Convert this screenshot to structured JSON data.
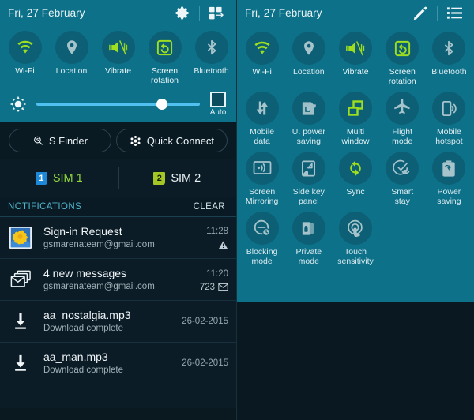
{
  "left_panel": {
    "header": {
      "date": "Fri, 27 February",
      "settings_icon": "gear-icon",
      "grid_icon": "toggle-arrange-icon"
    },
    "toggles": [
      {
        "label": "Wi-Fi",
        "icon": "wifi-icon",
        "active": true
      },
      {
        "label": "Location",
        "icon": "location-pin-icon",
        "active": false
      },
      {
        "label": "Vibrate",
        "icon": "vibrate-icon",
        "active": true
      },
      {
        "label": "Screen\nrotation",
        "label_lines": [
          "Screen",
          "rotation"
        ],
        "icon": "screen-rotation-icon",
        "active": true
      },
      {
        "label": "Bluetooth",
        "icon": "bluetooth-icon",
        "active": false
      }
    ],
    "brightness": {
      "icon": "brightness-sun-icon",
      "value": 77,
      "auto_label": "Auto",
      "auto_checked": false
    },
    "actions": [
      {
        "label": "S Finder",
        "icon": "s-finder-icon"
      },
      {
        "label": "Quick Connect",
        "icon": "quick-connect-icon"
      }
    ],
    "sim": [
      {
        "badge": "1",
        "label": "SIM 1",
        "badge_color": "#1e88d8",
        "text_color": "#8fd43c"
      },
      {
        "badge": "2",
        "label": "SIM 2",
        "badge_color": "#a4c726",
        "text_color": "#e8f1f4"
      }
    ],
    "notifications_header": {
      "title": "NOTIFICATIONS",
      "clear_label": "CLEAR"
    },
    "notifications": [
      {
        "icon": "photo-flower-icon",
        "title": "Sign-in Request",
        "subtitle": "gsmarenateam@gmail.com",
        "time": "11:28",
        "badge_text": "",
        "badge_icon": "warning-triangle-icon"
      },
      {
        "icon": "gmail-stack-icon",
        "title": "4 new messages",
        "subtitle": "gsmarenateam@gmail.com",
        "time": "11:20",
        "badge_text": "723",
        "badge_icon": "mail-icon"
      },
      {
        "icon": "download-icon",
        "title": "aa_nostalgia.mp3",
        "subtitle": "Download complete",
        "time": "26-02-2015",
        "badge_text": "",
        "badge_icon": ""
      },
      {
        "icon": "download-icon",
        "title": "aa_man.mp3",
        "subtitle": "Download complete",
        "time": "26-02-2015",
        "badge_text": "",
        "badge_icon": ""
      }
    ]
  },
  "right_panel": {
    "header": {
      "date": "Fri, 27 February",
      "edit_icon": "pencil-icon",
      "list_icon": "list-view-icon"
    },
    "toggles": [
      {
        "label_lines": [
          "Wi-Fi"
        ],
        "icon": "wifi-icon",
        "active": true
      },
      {
        "label_lines": [
          "Location"
        ],
        "icon": "location-pin-icon",
        "active": false
      },
      {
        "label_lines": [
          "Vibrate"
        ],
        "icon": "vibrate-icon",
        "active": true
      },
      {
        "label_lines": [
          "Screen",
          "rotation"
        ],
        "icon": "screen-rotation-icon",
        "active": true
      },
      {
        "label_lines": [
          "Bluetooth"
        ],
        "icon": "bluetooth-icon",
        "active": false
      },
      {
        "label_lines": [
          "Mobile",
          "data"
        ],
        "icon": "mobile-data-icon",
        "active": false
      },
      {
        "label_lines": [
          "U. power",
          "saving"
        ],
        "icon": "ultra-power-saving-icon",
        "active": false
      },
      {
        "label_lines": [
          "Multi",
          "window"
        ],
        "icon": "multi-window-icon",
        "active": true
      },
      {
        "label_lines": [
          "Flight",
          "mode"
        ],
        "icon": "airplane-icon",
        "active": false
      },
      {
        "label_lines": [
          "Mobile",
          "hotspot"
        ],
        "icon": "mobile-hotspot-icon",
        "active": false
      },
      {
        "label_lines": [
          "Screen",
          "Mirroring"
        ],
        "icon": "screen-mirroring-icon",
        "active": false
      },
      {
        "label_lines": [
          "Side key",
          "panel"
        ],
        "icon": "side-key-panel-icon",
        "active": false
      },
      {
        "label_lines": [
          "Sync"
        ],
        "icon": "sync-icon",
        "active": true
      },
      {
        "label_lines": [
          "Smart",
          "stay"
        ],
        "icon": "smart-stay-icon",
        "active": false
      },
      {
        "label_lines": [
          "Power",
          "saving"
        ],
        "icon": "power-saving-icon",
        "active": false
      },
      {
        "label_lines": [
          "Blocking",
          "mode"
        ],
        "icon": "blocking-mode-icon",
        "active": false
      },
      {
        "label_lines": [
          "Private",
          "mode"
        ],
        "icon": "private-mode-icon",
        "active": false
      },
      {
        "label_lines": [
          "Touch",
          "sensitivity"
        ],
        "icon": "touch-sensitivity-icon",
        "active": false
      }
    ]
  },
  "colors": {
    "teal_bg": "#0d7189",
    "circle_bg": "#0c5f74",
    "accent_green": "#9ede1f",
    "inactive_icon": "#a7c4cc",
    "dark_bg": "#0b1c26",
    "slider_track": "#4fc0ef",
    "notif_header_text": "#4fb6cd"
  }
}
